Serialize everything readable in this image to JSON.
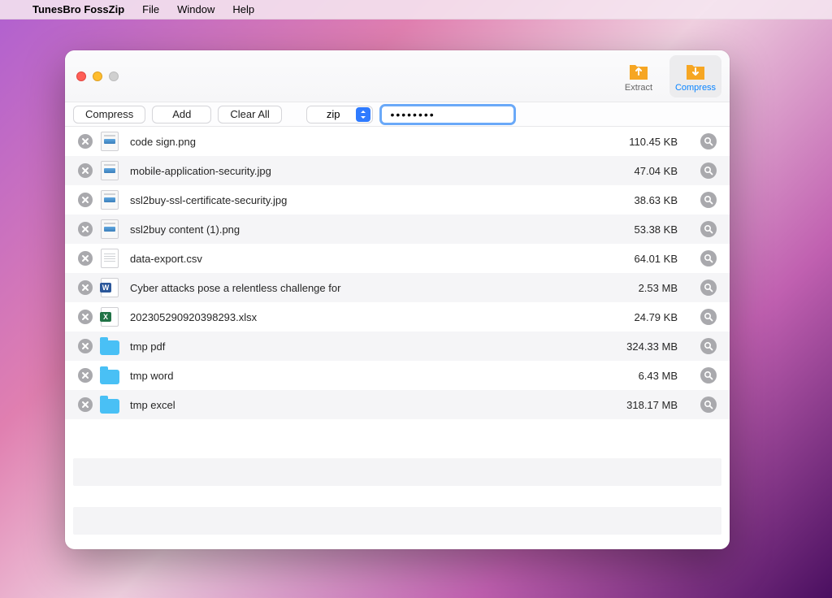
{
  "menubar": {
    "app_name": "TunesBro FossZip",
    "items": [
      "File",
      "Window",
      "Help"
    ]
  },
  "titlebar": {
    "modes": {
      "extract": {
        "label": "Extract",
        "active": false
      },
      "compress": {
        "label": "Compress",
        "active": true
      }
    }
  },
  "toolbar": {
    "compress_label": "Compress",
    "add_label": "Add",
    "clear_label": "Clear All",
    "format": {
      "selected": "zip"
    },
    "password_mask": "●●●●●●●●"
  },
  "files": [
    {
      "name": "code sign.png",
      "size": "110.45 KB",
      "type": "img"
    },
    {
      "name": "mobile-application-security.jpg",
      "size": "47.04 KB",
      "type": "img"
    },
    {
      "name": "ssl2buy-ssl-certificate-security.jpg",
      "size": "38.63 KB",
      "type": "img"
    },
    {
      "name": "ssl2buy content (1).png",
      "size": "53.38 KB",
      "type": "img"
    },
    {
      "name": "data-export.csv",
      "size": "64.01 KB",
      "type": "txt"
    },
    {
      "name": "Cyber attacks pose a relentless challenge for",
      "size": "2.53 MB",
      "type": "docx"
    },
    {
      "name": "202305290920398293.xlsx",
      "size": "24.79 KB",
      "type": "xlsx"
    },
    {
      "name": "tmp pdf",
      "size": "324.33 MB",
      "type": "folder"
    },
    {
      "name": "tmp word",
      "size": "6.43 MB",
      "type": "folder"
    },
    {
      "name": "tmp excel",
      "size": "318.17 MB",
      "type": "folder"
    }
  ],
  "colors": {
    "accent": "#0a84ff",
    "mode_icon": "#f6a623"
  }
}
